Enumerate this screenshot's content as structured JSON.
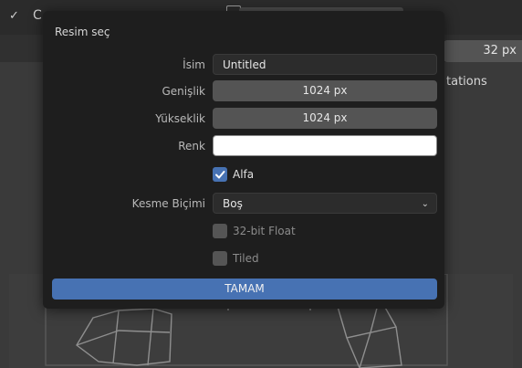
{
  "background": {
    "header_letter": "C",
    "size_value": "32 px",
    "panel_label": "tations"
  },
  "dialog": {
    "title": "Resim seç",
    "name": {
      "label": "İsim",
      "value": "Untitled"
    },
    "width": {
      "label": "Genişlik",
      "value": "1024 px"
    },
    "height": {
      "label": "Yükseklik",
      "value": "1024 px"
    },
    "color": {
      "label": "Renk",
      "value_hex": "#ffffff"
    },
    "alpha": {
      "label": "Alfa",
      "checked": true
    },
    "generated_type": {
      "label": "Kesme Biçimi",
      "value": "Boş"
    },
    "float32": {
      "label": "32-bit Float",
      "checked": false
    },
    "tiled": {
      "label": "Tiled",
      "checked": false
    },
    "ok_label": "TAMAM"
  },
  "colors": {
    "accent": "#4772b3",
    "dialog_bg": "#1e1e1e",
    "field_bg": "#2c2c2c",
    "num_field_bg": "#545454"
  }
}
